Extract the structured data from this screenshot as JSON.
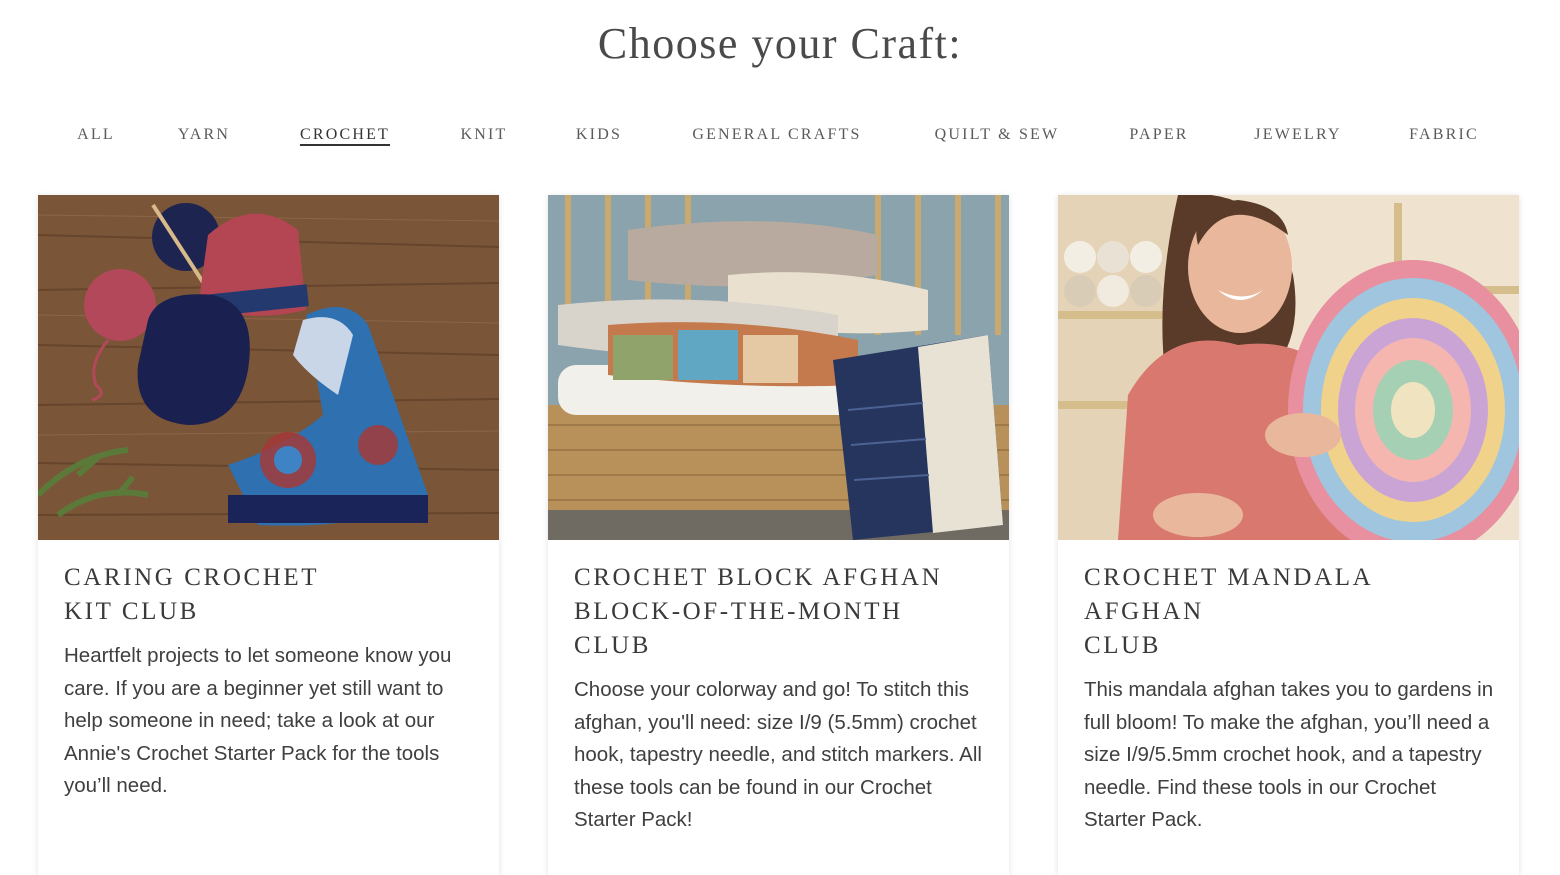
{
  "heading": "Choose your Craft:",
  "nav": {
    "items": [
      {
        "label": "ALL",
        "active": false
      },
      {
        "label": "YARN",
        "active": false
      },
      {
        "label": "CROCHET",
        "active": true
      },
      {
        "label": "KNIT",
        "active": false
      },
      {
        "label": "KIDS",
        "active": false
      },
      {
        "label": "GENERAL CRAFTS",
        "active": false
      },
      {
        "label": "QUILT & SEW",
        "active": false
      },
      {
        "label": "PAPER",
        "active": false
      },
      {
        "label": "JEWELRY",
        "active": false
      },
      {
        "label": "FABRIC",
        "active": false
      }
    ]
  },
  "cards": [
    {
      "title": "CARING CROCHET\nKIT CLUB",
      "description": "Heartfelt projects to let someone know you care. If you are a beginner yet still want to help someone in need; take a look at our Annie's Crochet Starter Pack for the tools you’ll need."
    },
    {
      "title": "CROCHET BLOCK AFGHAN\nBLOCK-OF-THE-MONTH\nCLUB",
      "description": "Choose your colorway and go! To stitch this afghan, you'll need: size I/9 (5.5mm) crochet hook, tapestry needle, and stitch markers. All these tools can be found in our Crochet Starter Pack!"
    },
    {
      "title": "CROCHET MANDALA\nAFGHAN\nCLUB",
      "description": "This mandala afghan takes you to gardens in full bloom! To make the afghan, you’ll need a size I/9/5.5mm crochet hook, and a tapestry needle. Find these tools in our Crochet Starter Pack."
    }
  ]
}
